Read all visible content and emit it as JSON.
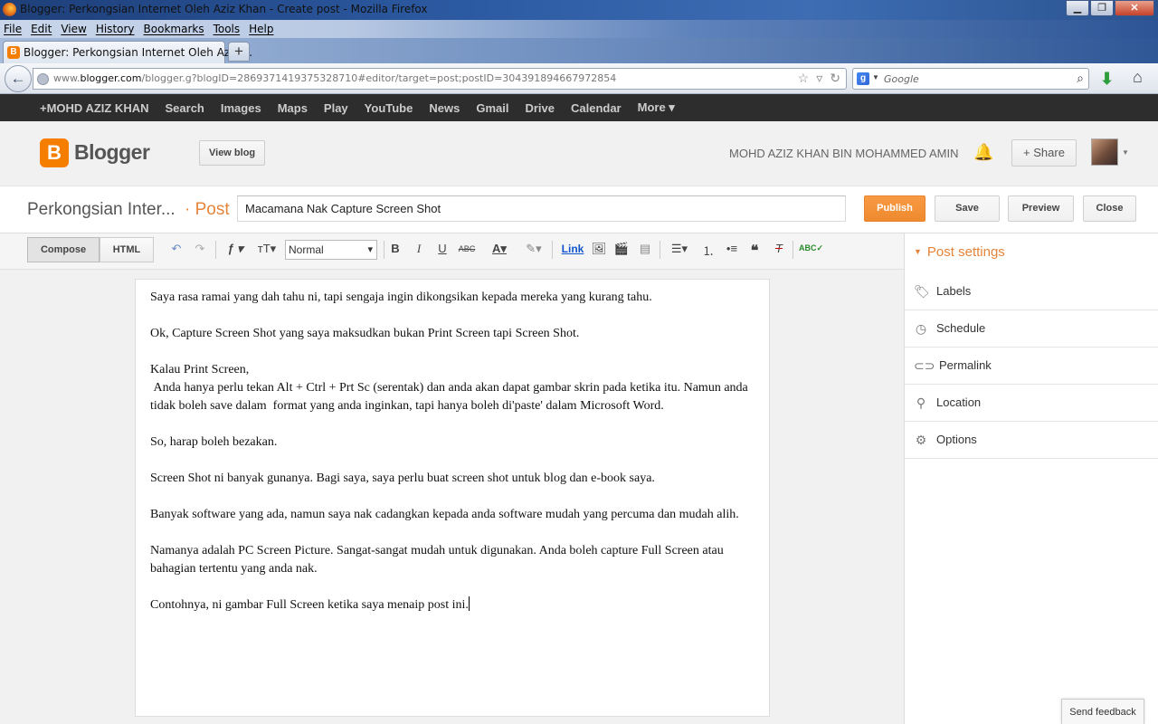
{
  "window": {
    "title": "Blogger: Perkongsian Internet Oleh Aziz Khan - Create post - Mozilla Firefox",
    "buttons": {
      "minimize": "▁",
      "maximize": "❐",
      "close": "✕"
    }
  },
  "menubar": [
    "File",
    "Edit",
    "View",
    "History",
    "Bookmarks",
    "Tools",
    "Help"
  ],
  "tab": {
    "title": "Blogger: Perkongsian Internet Oleh Aziz ...",
    "new_tab": "+"
  },
  "navbar": {
    "url_prefix": "www.",
    "url_domain": "blogger.com",
    "url_path": "/blogger.g?blogID=2869371419375328710#editor/target=post;postID=3043918946679​72854",
    "search_placeholder": "Google"
  },
  "gbar": [
    "+MOHD AZIZ KHAN",
    "Search",
    "Images",
    "Maps",
    "Play",
    "YouTube",
    "News",
    "Gmail",
    "Drive",
    "Calendar",
    "More ▾"
  ],
  "header": {
    "logo_text": "Blogger",
    "view_blog": "View blog",
    "username": "MOHD AZIZ KHAN BIN MOHAMMED AMIN",
    "share": "Share"
  },
  "postrow": {
    "blog_name": "Perkongsian Inter...",
    "post_label": "· Post",
    "title_value": "Macamana Nak Capture Screen Shot",
    "publish": "Publish",
    "save": "Save",
    "preview": "Preview",
    "close": "Close"
  },
  "toolbar": {
    "compose": "Compose",
    "html": "HTML",
    "font_size": "Normal",
    "link": "Link"
  },
  "editor": {
    "paragraphs": [
      "Saya rasa ramai yang dah tahu ni, tapi sengaja ingin dikongsikan kepada mereka yang kurang tahu.",
      "Ok, Capture Screen Shot yang saya maksudkan bukan Print Screen tapi Screen Shot.",
      "Kalau Print Screen,\n Anda hanya perlu tekan Alt + Ctrl + Prt Sc (serentak) dan anda akan dapat gambar skrin pada ketika itu. Namun anda tidak boleh save dalam  format yang anda inginkan, tapi hanya boleh di'paste' dalam Microsoft Word.",
      "So, harap boleh bezakan.",
      "Screen Shot ni banyak gunanya. Bagi saya, saya perlu buat screen shot untuk blog dan e-book saya.",
      "Banyak software yang ada, namun saya nak cadangkan kepada anda software mudah yang percuma dan mudah alih.",
      "Namanya adalah PC Screen Picture. Sangat-sangat mudah untuk digunakan. Anda boleh capture Full Screen atau bahagian tertentu yang anda nak.",
      "Contohnya, ni gambar Full Screen ketika saya menaip post ini."
    ]
  },
  "sidebar": {
    "heading": "Post settings",
    "items": [
      "Labels",
      "Schedule",
      "Permalink",
      "Location",
      "Options"
    ]
  },
  "feedback": "Send feedback",
  "colors": {
    "accent": "#f57d00",
    "publish": "#ef8a2f",
    "gbar": "#2d2d2d"
  }
}
